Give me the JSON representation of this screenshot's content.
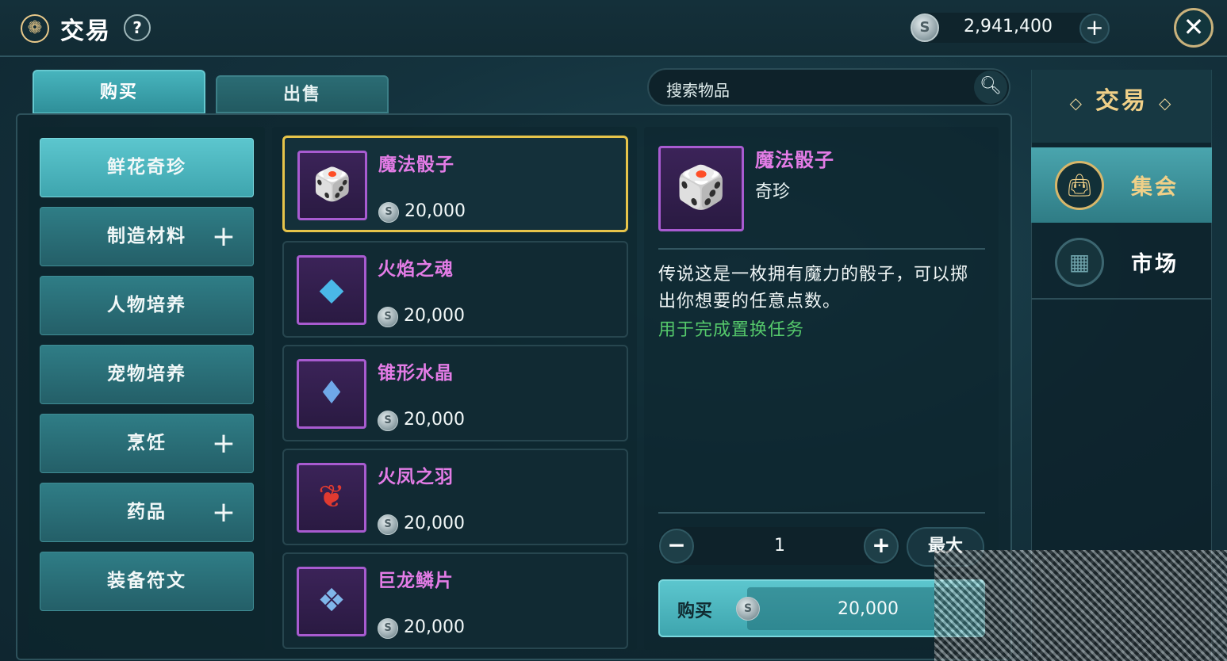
{
  "header": {
    "title": "交易",
    "title_icon": "gear-flower-icon",
    "help_label": "?",
    "currency_icon": "silver-coin-icon",
    "currency_value": "2,941,400",
    "add_label": "+",
    "close_label": "✕"
  },
  "tabs": [
    {
      "label": "购买",
      "active": true
    },
    {
      "label": "出售",
      "active": false
    }
  ],
  "search": {
    "placeholder": "搜索物品"
  },
  "categories": [
    {
      "label": "鲜花奇珍",
      "active": true,
      "expandable": false
    },
    {
      "label": "制造材料",
      "active": false,
      "expandable": true
    },
    {
      "label": "人物培养",
      "active": false,
      "expandable": false
    },
    {
      "label": "宠物培养",
      "active": false,
      "expandable": false
    },
    {
      "label": "烹饪",
      "active": false,
      "expandable": true
    },
    {
      "label": "药品",
      "active": false,
      "expandable": true
    },
    {
      "label": "装备符文",
      "active": false,
      "expandable": false
    }
  ],
  "items": [
    {
      "name": "魔法骰子",
      "price": "20,000",
      "icon": "dice-icon",
      "selected": true
    },
    {
      "name": "火焰之魂",
      "price": "20,000",
      "icon": "fire-crystal-icon",
      "selected": false
    },
    {
      "name": "锥形水晶",
      "price": "20,000",
      "icon": "pendulum-crystal-icon",
      "selected": false
    },
    {
      "name": "火凤之羽",
      "price": "20,000",
      "icon": "red-feather-icon",
      "selected": false
    },
    {
      "name": "巨龙鳞片",
      "price": "20,000",
      "icon": "dragon-scale-icon",
      "selected": false
    }
  ],
  "detail": {
    "name": "魔法骰子",
    "type": "奇珍",
    "description": "传说这是一枚拥有魔力的骰子，可以掷出你想要的任意点数。",
    "usage": "用于完成置换任务",
    "quantity": "1",
    "minus_label": "−",
    "plus_label": "+",
    "max_label": "最大",
    "buy_label": "购买",
    "buy_price": "20,000"
  },
  "right_nav": {
    "title": "交易",
    "items": [
      {
        "label": "集会",
        "icon": "shopping-bag-icon",
        "active": true
      },
      {
        "label": "市场",
        "icon": "market-stall-icon",
        "active": false
      }
    ]
  },
  "colors": {
    "accent_teal": "#3ea5ae",
    "item_name_purple": "#e37ce6",
    "usage_green": "#55c96b",
    "selection_gold": "#e6c44a"
  }
}
